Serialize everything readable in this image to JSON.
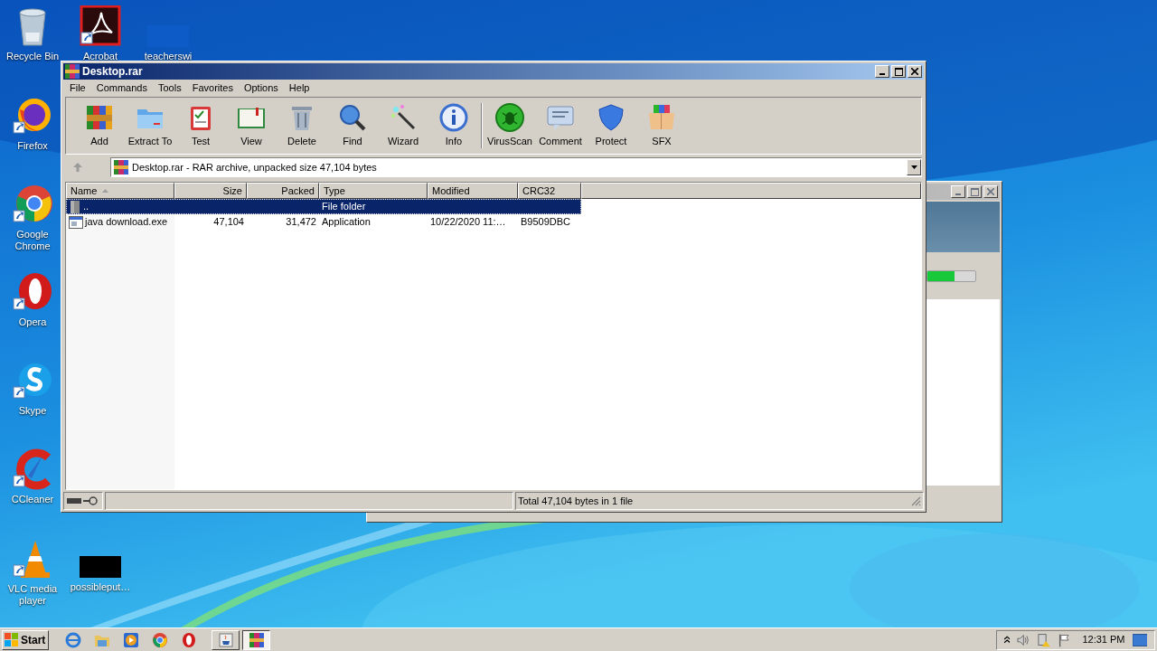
{
  "desktop_icons": [
    {
      "label": "Recycle Bin"
    },
    {
      "label": "Firefox"
    },
    {
      "label": "Google Chrome"
    },
    {
      "label": "Opera"
    },
    {
      "label": "Skype"
    },
    {
      "label": "CCleaner"
    },
    {
      "label": "VLC media player"
    },
    {
      "label": "Acrobat"
    },
    {
      "label": "teacherswi"
    },
    {
      "label": "possibleput…"
    }
  ],
  "background_window": {
    "progress": {
      "level": 0.56
    }
  },
  "window": {
    "title": "Desktop.rar",
    "menu": [
      "File",
      "Commands",
      "Tools",
      "Favorites",
      "Options",
      "Help"
    ],
    "toolbar": {
      "groups": [
        [
          "Add",
          "Extract To",
          "Test",
          "View",
          "Delete",
          "Find",
          "Wizard",
          "Info"
        ],
        [
          "VirusScan",
          "Comment",
          "Protect",
          "SFX"
        ]
      ]
    },
    "address": "Desktop.rar - RAR archive, unpacked size 47,104 bytes",
    "table": {
      "columns": [
        {
          "label": "Name",
          "sorted": true
        },
        {
          "label": "Size",
          "sorted": false
        },
        {
          "label": "Packed",
          "sorted": false
        },
        {
          "label": "Type",
          "sorted": false
        },
        {
          "label": "Modified",
          "sorted": false
        },
        {
          "label": "CRC32",
          "sorted": false
        }
      ],
      "rows": [
        {
          "kind": "folder",
          "selected": true,
          "name": "..",
          "type": "File folder"
        },
        {
          "kind": "file",
          "selected": false,
          "name": "java download.exe",
          "size": "47,104",
          "packed": "31,472",
          "type": "Application",
          "modified": "10/22/2020 11:…",
          "crc32": "B9509DBC"
        }
      ]
    },
    "status": "Total 47,104 bytes in 1 file"
  },
  "taskbar": {
    "start": "Start",
    "tasks": [
      {
        "selected": false
      },
      {
        "selected": true
      }
    ],
    "clock": "12:31 PM"
  }
}
